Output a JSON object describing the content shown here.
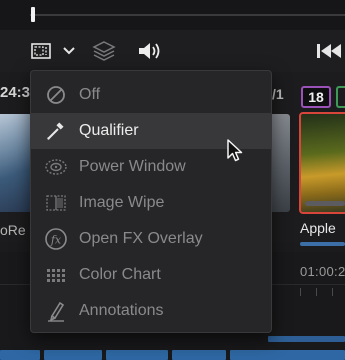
{
  "viewer": {
    "playhead_progress_percent": 0.5
  },
  "toolbar": {
    "overlay_icon": "view-overlay-icon",
    "dropdown_icon": "chevron-down-icon",
    "layers_icon": "layers-icon",
    "audio_icon": "speaker-icon",
    "skip_icon": "skip-to-start-icon"
  },
  "clips": {
    "left_number": "24:3",
    "left_name": "oRe",
    "mid_number": "/1",
    "active_badge": "18",
    "active_name": "Apple",
    "badge_color": "#9a52b8",
    "active_border_color": "#d8453b"
  },
  "timeline": {
    "timecode": "01:00:2"
  },
  "menu": {
    "items": [
      {
        "label": "Off",
        "icon": "off-circle-icon"
      },
      {
        "label": "Qualifier",
        "icon": "eyedropper-icon",
        "highlighted": true
      },
      {
        "label": "Power Window",
        "icon": "power-window-icon"
      },
      {
        "label": "Image Wipe",
        "icon": "image-wipe-icon"
      },
      {
        "label": "Open FX Overlay",
        "icon": "fx-icon"
      },
      {
        "label": "Color Chart",
        "icon": "color-chart-icon"
      },
      {
        "label": "Annotations",
        "icon": "annotation-pen-icon"
      }
    ]
  }
}
